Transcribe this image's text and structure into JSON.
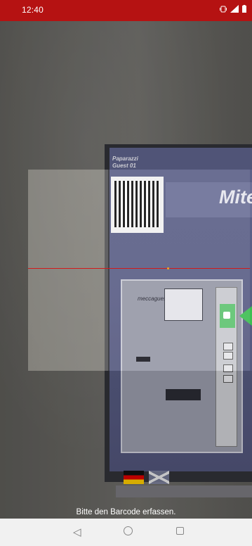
{
  "status_bar": {
    "time": "12:40",
    "icons": [
      "vibrate-icon",
      "signal-icon",
      "battery-icon"
    ],
    "background": "#b51212"
  },
  "camera_preview": {
    "ticket_header": "Paparazzi",
    "ticket_subheader": "Guest 01",
    "screen_title": "Mite",
    "panel_label": "meccaguest"
  },
  "scanner": {
    "hint": "Bitte den Barcode erfassen.",
    "line_color": "#d21a1a"
  },
  "nav_bar": {
    "back": "◁",
    "buttons": [
      "back-icon",
      "home-icon",
      "recent-apps-icon"
    ]
  }
}
